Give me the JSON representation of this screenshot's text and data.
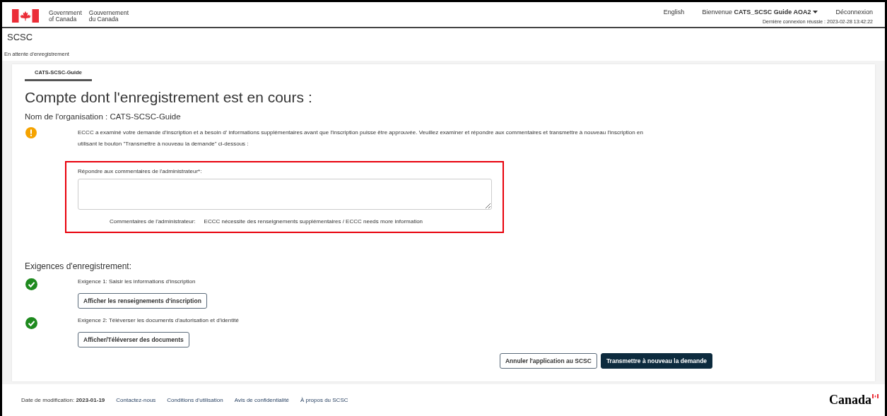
{
  "header": {
    "signature_en": [
      "Government",
      "of Canada"
    ],
    "signature_fr": [
      "Gouvernement",
      "du Canada"
    ],
    "language_link": "English",
    "welcome": "Bienvenue **CATS_SCSC Guide AOA2**",
    "logout": "Déconnexion",
    "last_login": "Dernière connexion réussie : 2023-02-28 13:42:22"
  },
  "app_title": "SCSC",
  "breadcrumb": "En attente d'enregistrement",
  "tabs": [
    {
      "label": "CATS-SCSC-Guide",
      "selected": true
    }
  ],
  "page_title": "Compte dont l'enregistrement est en cours :",
  "organization": "Nom de l'organisation : CATS-SCSC-Guide",
  "warning": {
    "kind": "warning",
    "text": "ECCC a examiné votre demande d'inscription et a besoin d' informations supplémentaires avant que l'inscription puisse être approuvée. Veuillez examiner et répondre aux commentaires et transmettre à nouveau l'inscription en utilisant le bouton \"Transmettre à nouveau la demande\" ci-dessous :"
  },
  "response": {
    "label": "Répondre aux commentaires de l'administrateur*:",
    "highlighted": true,
    "admin_comments_label": "Commentaires de l'administrateur:",
    "admin_comments": "ECCC nécessite des renseignements supplémentaires / ECCC needs more information"
  },
  "requirements_title": "Exigences d'enregistrement:",
  "requirements": [
    {
      "done": true,
      "text": "Exigence 1: Saisir les informations d'inscription",
      "button": "Afficher les renseignements d'inscription"
    },
    {
      "done": true,
      "text": "Exigence 2: Téléverser les documents d'autorisation et d'identité",
      "button": "Afficher/Téléverser des documents"
    }
  ],
  "actions": [
    {
      "kind": "secondary",
      "label": "Annuler l'application au SCSC"
    },
    {
      "kind": "primary",
      "label": "Transmettre à nouveau la demande"
    }
  ],
  "footer": {
    "modified": "Date de modification: **2023-01-19**",
    "links": [
      "Contactez-nous",
      "Conditions d'utilisation",
      "Avis de confidentialité",
      "À propos du SCSC"
    ],
    "wordmark": "Canada"
  }
}
